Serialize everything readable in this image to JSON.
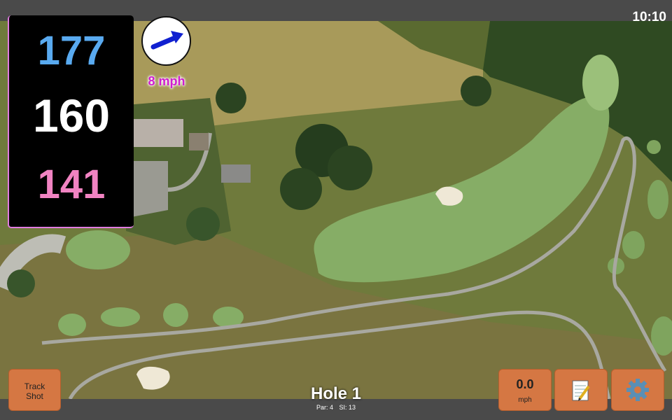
{
  "clock": "10:10",
  "yardages": {
    "back": "177",
    "middle": "160",
    "front": "141"
  },
  "wind": {
    "speed": "8 mph",
    "direction_icon": "arrow-up-right"
  },
  "hole": {
    "title": "Hole 1",
    "par": "Par: 4",
    "stroke_index": "SI: 13"
  },
  "buttons": {
    "track_shot_line1": "Track",
    "track_shot_line2": "Shot",
    "speed_value": "0.0",
    "speed_unit": "mph",
    "notes_icon": "notepad-icon",
    "settings_icon": "gear-icon"
  },
  "colors": {
    "back": "#59aaf0",
    "middle": "#ffffff",
    "front": "#f183c2",
    "button": "#d57743",
    "wind_text": "#cf1dcf"
  }
}
